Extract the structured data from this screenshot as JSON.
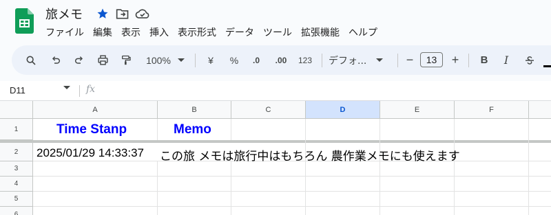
{
  "header": {
    "doc_title": "旅メモ",
    "star_color": "#0b57d0",
    "icons": [
      "star-icon",
      "move-folder-icon",
      "cloud-saved-icon"
    ]
  },
  "menu": [
    "ファイル",
    "編集",
    "表示",
    "挿入",
    "表示形式",
    "データ",
    "ツール",
    "拡張機能",
    "ヘルプ"
  ],
  "toolbar": {
    "zoom": "100%",
    "currency": "¥",
    "percent": "%",
    "decrease_decimal": ".0",
    "increase_decimal": ".00",
    "number_format": "123",
    "font": "デフォ...",
    "font_size": "13",
    "minus": "−",
    "plus": "+",
    "bold": "B",
    "italic": "I"
  },
  "formula_bar": {
    "name_box": "D11",
    "fx": "fx"
  },
  "columns": [
    "A",
    "B",
    "C",
    "D",
    "E",
    "F"
  ],
  "selected_column": "D",
  "rows": [
    "1",
    "2",
    "3",
    "4",
    "5",
    "6"
  ],
  "cells": {
    "A1": "Time Stanp",
    "B1": "Memo",
    "A2": "2025/01/29 14:33:37",
    "B2": "この旅 メモは旅行中はもちろん 農作業メモにも使えます"
  },
  "colors": {
    "header_text": "#0000ff",
    "accent": "#0b57d0",
    "sheets_green": "#0f9d58"
  }
}
